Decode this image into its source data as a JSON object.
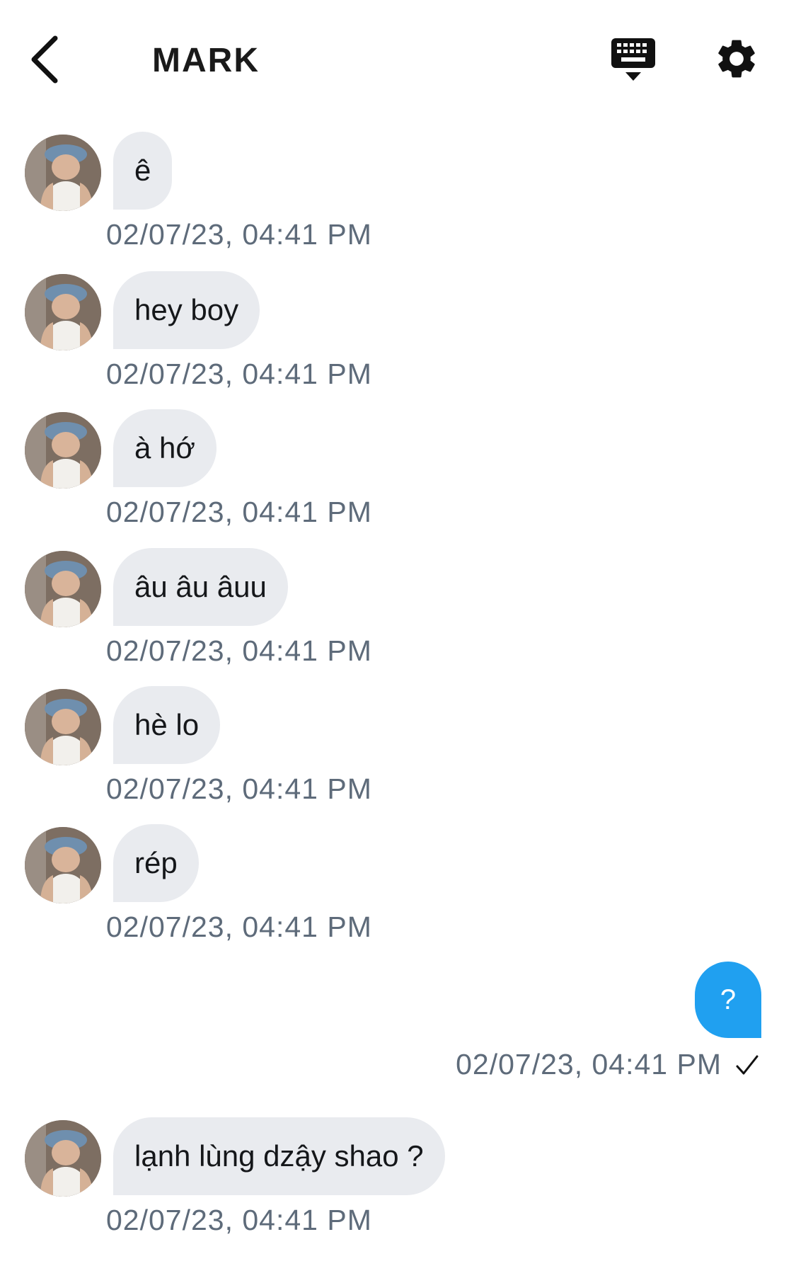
{
  "header": {
    "title": "MARK",
    "back_icon": "chevron-left-icon",
    "keyboard_icon": "keyboard-icon",
    "settings_icon": "gear-icon"
  },
  "colors": {
    "incoming_bubble": "#e9ebef",
    "outgoing_bubble": "#20a0f0",
    "timestamp": "#5e6b7a"
  },
  "messages": [
    {
      "direction": "incoming",
      "text": "ê",
      "time": "02/07/23, 04:41 PM"
    },
    {
      "direction": "incoming",
      "text": "hey boy",
      "time": "02/07/23, 04:41 PM"
    },
    {
      "direction": "incoming",
      "text": "à hớ",
      "time": "02/07/23, 04:41 PM"
    },
    {
      "direction": "incoming",
      "text": "âu âu âuu",
      "time": "02/07/23, 04:41 PM"
    },
    {
      "direction": "incoming",
      "text": "hè lo",
      "time": "02/07/23, 04:41 PM"
    },
    {
      "direction": "incoming",
      "text": "rép",
      "time": "02/07/23, 04:41 PM"
    },
    {
      "direction": "outgoing",
      "text": "?",
      "time": "02/07/23, 04:41 PM",
      "status_icon": "checkmark-icon"
    },
    {
      "direction": "incoming",
      "text": "lạnh lùng dzậy shao ?",
      "time": "02/07/23, 04:41 PM"
    }
  ]
}
